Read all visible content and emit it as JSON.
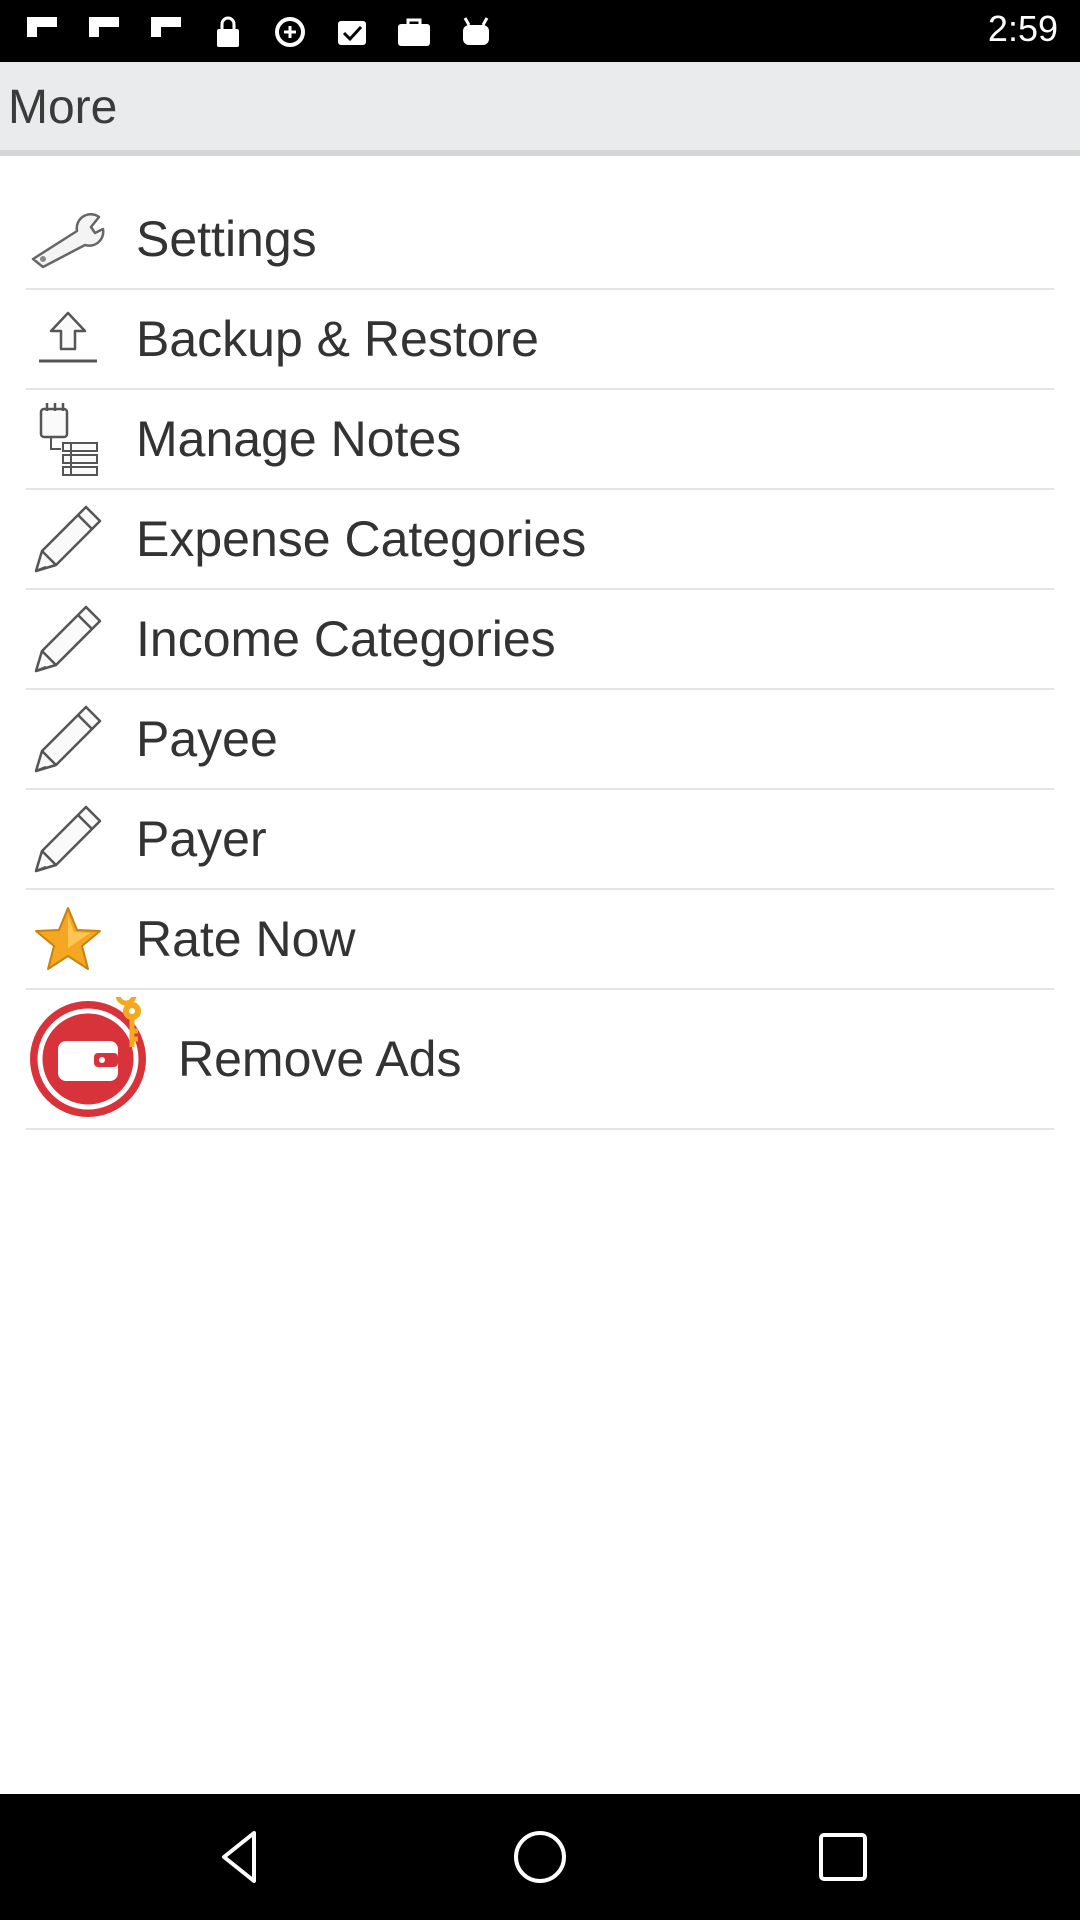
{
  "status_bar": {
    "time": "2:59",
    "icons": [
      "flipboard-icon",
      "flipboard-icon",
      "flipboard-icon",
      "lock-icon",
      "data-saver-icon",
      "checkbox-icon",
      "briefcase-icon",
      "android-icon"
    ]
  },
  "header": {
    "title": "More"
  },
  "menu": {
    "items": [
      {
        "label": "Settings",
        "icon": "wrench-icon"
      },
      {
        "label": "Backup & Restore",
        "icon": "upload-icon"
      },
      {
        "label": "Manage Notes",
        "icon": "notes-icon"
      },
      {
        "label": "Expense Categories",
        "icon": "pencil-icon"
      },
      {
        "label": "Income Categories",
        "icon": "pencil-icon"
      },
      {
        "label": "Payee",
        "icon": "pencil-icon"
      },
      {
        "label": "Payer",
        "icon": "pencil-icon"
      },
      {
        "label": "Rate Now",
        "icon": "star-icon"
      },
      {
        "label": "Remove Ads",
        "icon": "wallet-key-icon"
      }
    ]
  },
  "nav_bar": {
    "buttons": [
      "back-icon",
      "home-icon",
      "recents-icon"
    ]
  },
  "colors": {
    "header_bg": "#e9ebec",
    "star": "#f5a623",
    "wallet_red": "#d8333b"
  }
}
